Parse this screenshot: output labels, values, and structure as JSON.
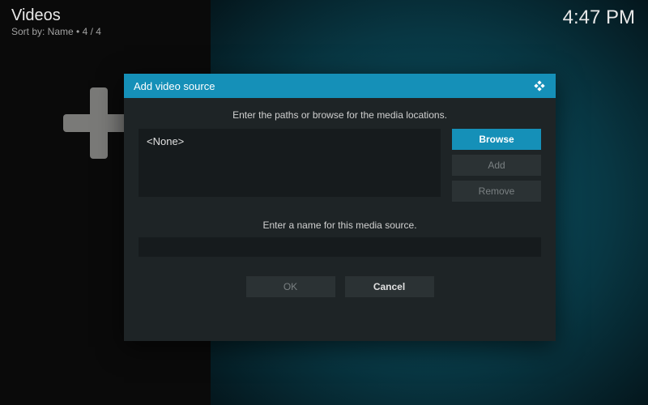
{
  "header": {
    "title": "Videos",
    "sort_prefix": "Sort by: Name",
    "sort_sep": "•",
    "sort_count": "4 / 4"
  },
  "clock": "4:47 PM",
  "dialog": {
    "title": "Add video source",
    "instruction_paths": "Enter the paths or browse for the media locations.",
    "path_value": "<None>",
    "browse_label": "Browse",
    "add_label": "Add",
    "remove_label": "Remove",
    "instruction_name": "Enter a name for this media source.",
    "name_value": "",
    "ok_label": "OK",
    "cancel_label": "Cancel"
  },
  "icons": {
    "add_source": "plus-icon",
    "app_logo": "kodi-icon"
  }
}
